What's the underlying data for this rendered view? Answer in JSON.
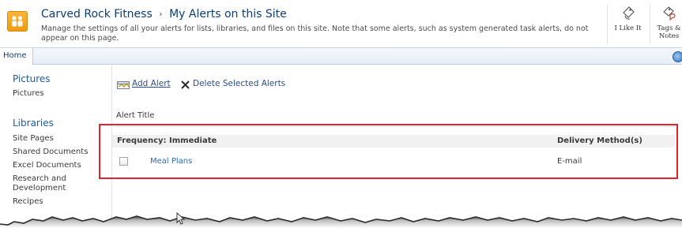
{
  "header": {
    "site_title": "Carved Rock Fitness",
    "separator": "›",
    "page_title": "My Alerts on this Site",
    "description": "Manage the settings of all your alerts for lists, libraries, and files on this site. Note that some alerts, such as system generated task alerts, do not appear on this page.",
    "logo_icon": "sharepoint-site-logo-icon",
    "i_like_it_label": "I Like It",
    "tags_notes_label": "Tags & Notes"
  },
  "nav": {
    "home_tab": "Home",
    "help_icon": "help-icon"
  },
  "quick_launch": {
    "pictures_heading": "Pictures",
    "pictures_items": [
      "Pictures"
    ],
    "libraries_heading": "Libraries",
    "libraries_items": [
      "Site Pages",
      "Shared Documents",
      "Excel Documents",
      "Research and Development",
      "Recipes"
    ]
  },
  "toolbar": {
    "add_alert_label": "Add Alert",
    "delete_label": "Delete Selected Alerts"
  },
  "alerts": {
    "column_label": "Alert Title",
    "frequency_label": "Frequency: Immediate",
    "delivery_header": "Delivery Method(s)",
    "rows": [
      {
        "name": "Meal Plans",
        "delivery": "E-mail",
        "checked": false
      }
    ]
  },
  "colors": {
    "link": "#2a6ab8",
    "title": "#0c3e7a",
    "highlight": "#e3242b",
    "group_row": "#f1f1f1"
  }
}
